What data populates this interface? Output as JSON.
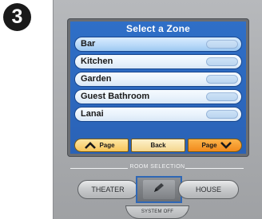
{
  "step_number": "3",
  "screen": {
    "title": "Select a Zone",
    "zones": [
      {
        "label": "Bar",
        "selected": true
      },
      {
        "label": "Kitchen",
        "selected": false
      },
      {
        "label": "Garden",
        "selected": false
      },
      {
        "label": "Guest Bathroom",
        "selected": false
      },
      {
        "label": "Lanai",
        "selected": false
      }
    ],
    "nav": {
      "page_up_label": "Page",
      "back_label": "Back",
      "page_down_label": "Page"
    }
  },
  "controls": {
    "room_selection_label": "ROOM SELECTION",
    "theater_label": "THEATER",
    "house_label": "HOUSE",
    "system_off_label": "SYSTEM OFF"
  },
  "colors": {
    "screen_blue": "#2a62b6",
    "nav_gold": "#f6c458",
    "nav_orange": "#f18a1c",
    "selection_highlight": "#2f67b5"
  },
  "icons": {
    "page_up": "chevron-up-icon",
    "page_down": "chevron-down-icon",
    "center_key": "pencil-icon"
  }
}
